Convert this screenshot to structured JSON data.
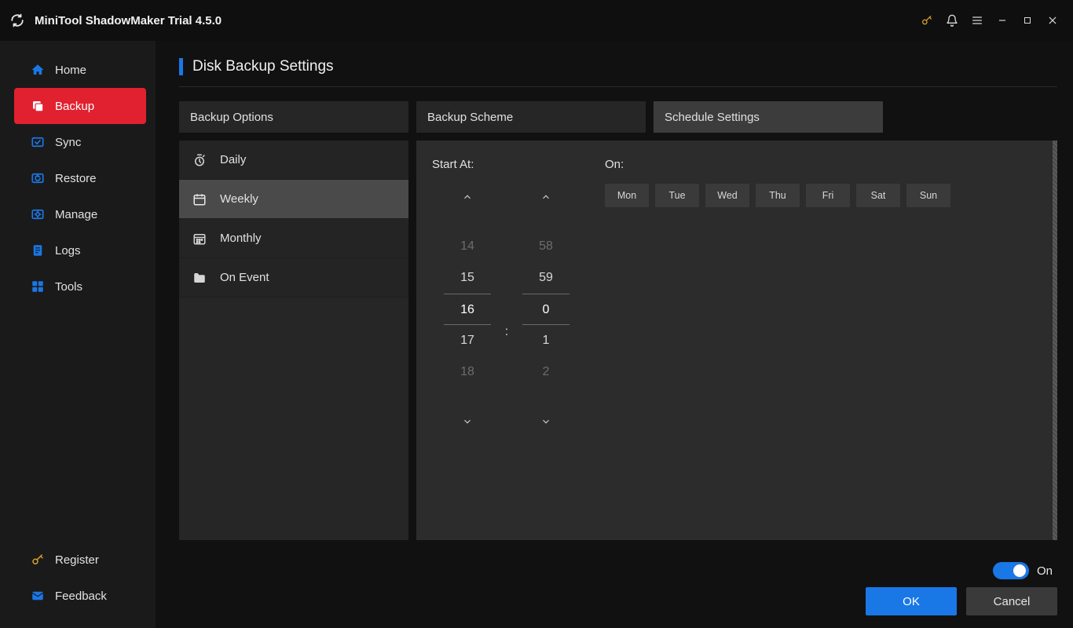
{
  "app": {
    "title": "MiniTool ShadowMaker Trial 4.5.0"
  },
  "sidebar": {
    "items": [
      {
        "label": "Home"
      },
      {
        "label": "Backup"
      },
      {
        "label": "Sync"
      },
      {
        "label": "Restore"
      },
      {
        "label": "Manage"
      },
      {
        "label": "Logs"
      },
      {
        "label": "Tools"
      }
    ],
    "bottom": [
      {
        "label": "Register"
      },
      {
        "label": "Feedback"
      }
    ]
  },
  "page": {
    "title": "Disk Backup Settings"
  },
  "tabs": [
    {
      "label": "Backup Options"
    },
    {
      "label": "Backup Scheme"
    },
    {
      "label": "Schedule Settings"
    }
  ],
  "sched_types": [
    {
      "label": "Daily"
    },
    {
      "label": "Weekly"
    },
    {
      "label": "Monthly"
    },
    {
      "label": "On Event"
    }
  ],
  "schedule": {
    "start_label": "Start At:",
    "on_label": "On:",
    "hours": {
      "minus2": "14",
      "minus1": "15",
      "sel": "16",
      "plus1": "17",
      "plus2": "18"
    },
    "minutes": {
      "minus2": "58",
      "minus1": "59",
      "sel": "0",
      "plus1": "1",
      "plus2": "2"
    },
    "sep": ":",
    "days": [
      "Mon",
      "Tue",
      "Wed",
      "Thu",
      "Fri",
      "Sat",
      "Sun"
    ]
  },
  "footer": {
    "toggle_label": "On",
    "ok": "OK",
    "cancel": "Cancel"
  }
}
